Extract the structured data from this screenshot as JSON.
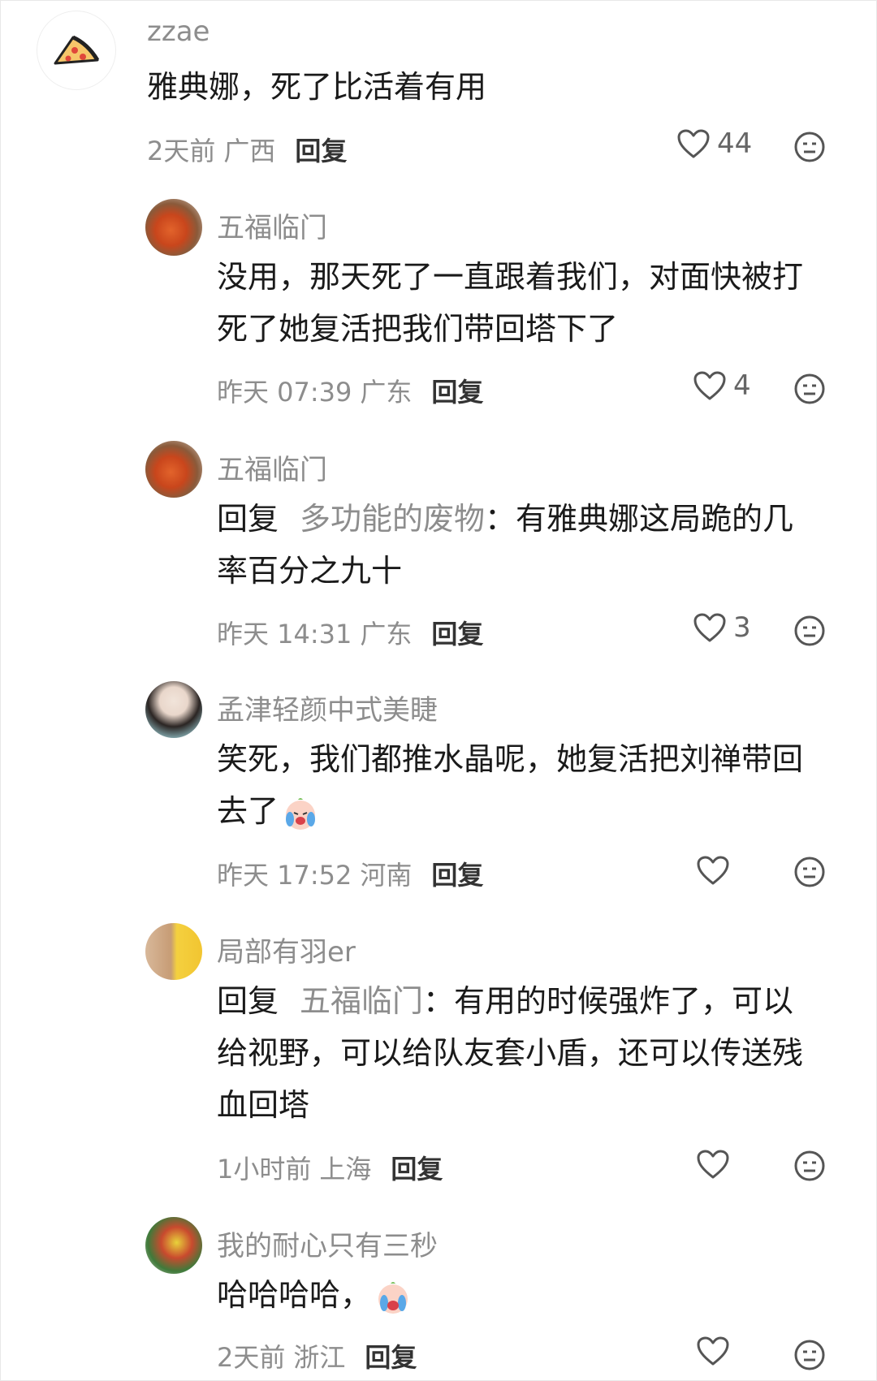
{
  "comments": [
    {
      "username": "zzae",
      "avatar_icon": "pizza-icon",
      "lines": [
        "雅典娜，死了比活着有用"
      ],
      "time": "2天前",
      "location": "广西",
      "reply_label": "回复",
      "likes": "44"
    },
    {
      "username": "五福临门",
      "avatar_icon": "avatar-photo",
      "lines": [
        "没用，那天死了一直跟着我们，对面快被打",
        "死了她复活把我们带回塔下了"
      ],
      "time": "昨天 07:39",
      "location": "广东",
      "reply_label": "回复",
      "likes": "4"
    },
    {
      "username": "五福临门",
      "avatar_icon": "avatar-photo",
      "reply_prefix": "回复",
      "reply_target": "多功能的废物",
      "lines": [
        "：有雅典娜这局跪的几",
        "率百分之九十"
      ],
      "time": "昨天 14:31",
      "location": "广东",
      "reply_label": "回复",
      "likes": "3"
    },
    {
      "username": "孟津轻颜中式美睫",
      "avatar_icon": "avatar-photo",
      "lines": [
        "笑死，我们都推水晶呢，她复活把刘禅带回",
        "去了"
      ],
      "time": "昨天 17:52",
      "location": "河南",
      "reply_label": "回复",
      "likes": ""
    },
    {
      "username": "局部有羽er",
      "avatar_icon": "avatar-photo",
      "reply_prefix": "回复",
      "reply_target": "五福临门",
      "lines": [
        "：有用的时候强炸了，可以",
        "给视野，可以给队友套小盾，还可以传送残",
        "血回塔"
      ],
      "time": "1小时前",
      "location": "上海",
      "reply_label": "回复",
      "likes": ""
    },
    {
      "username": "我的耐心只有三秒",
      "avatar_icon": "avatar-photo",
      "lines": [
        "哈哈哈哈，"
      ],
      "time": "2天前",
      "location": "浙江",
      "reply_label": "回复",
      "likes": ""
    }
  ]
}
